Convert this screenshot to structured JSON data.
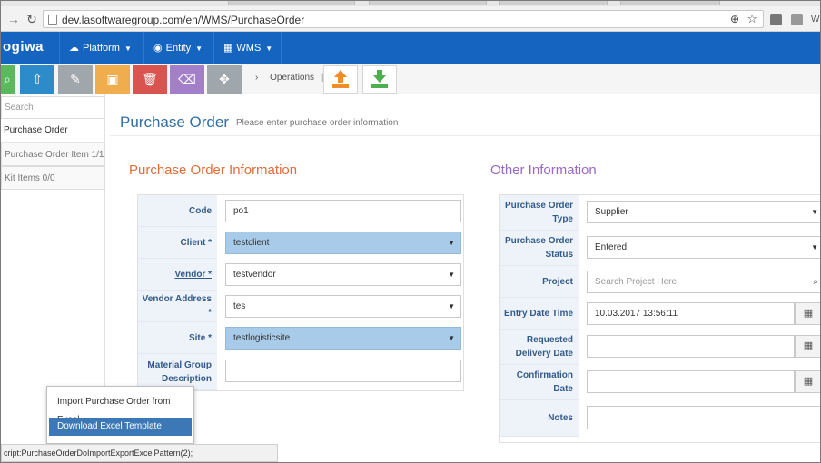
{
  "browser": {
    "url": "dev.lasoftwaregroup.com/en/WMS/PurchaseOrder",
    "right_label": "W"
  },
  "app": {
    "logo": "ogiwa",
    "nav": [
      {
        "label": "Platform",
        "icon": "cloud-icon"
      },
      {
        "label": "Entity",
        "icon": "globe-icon"
      },
      {
        "label": "WMS",
        "icon": "building-icon"
      }
    ]
  },
  "toolbar": {
    "buttons": [
      {
        "icon": "search-icon",
        "color": "#5cb85c"
      },
      {
        "icon": "upload-icon",
        "color": "#2e8bc9"
      },
      {
        "icon": "edit-icon",
        "color": "#a0a7ac"
      },
      {
        "icon": "save-icon",
        "color": "#f0ad4e"
      },
      {
        "icon": "delete-icon",
        "color": "#d9534f"
      },
      {
        "icon": "eraser-icon",
        "color": "#a47fc9"
      },
      {
        "icon": "move-icon",
        "color": "#a0a7ac"
      }
    ],
    "breadcrumb": "Operations",
    "export_icon": "export-upload-icon",
    "import_icon": "import-download-icon"
  },
  "sidebar": {
    "search_placeholder": "Search",
    "items": [
      {
        "label": "Purchase Order"
      },
      {
        "label": "Purchase Order Item 1/1"
      },
      {
        "label": "Kit Items 0/0"
      }
    ]
  },
  "page": {
    "title": "Purchase Order",
    "subtitle": "Please enter purchase order information"
  },
  "left_section": {
    "title": "Purchase Order Information",
    "fields": {
      "code": {
        "label": "Code",
        "value": "po1"
      },
      "client": {
        "label": "Client *",
        "value": "testclient"
      },
      "vendor": {
        "label": "Vendor *",
        "value": "testvendor"
      },
      "vendor_address": {
        "label": "Vendor Address *",
        "value": "tes"
      },
      "site": {
        "label": "Site *",
        "value": "testlogisticsite"
      },
      "material_group": {
        "label": "Material Group Description",
        "value": ""
      }
    }
  },
  "right_section": {
    "title": "Other Information",
    "fields": {
      "po_type": {
        "label": "Purchase Order Type",
        "value": "Supplier"
      },
      "po_status": {
        "label": "Purchase Order Status",
        "value": "Entered"
      },
      "project": {
        "label": "Project",
        "placeholder": "Search Project Here"
      },
      "entry_date": {
        "label": "Entry Date Time",
        "value": "10.03.2017 13:56:11"
      },
      "requested_delivery": {
        "label": "Requested Delivery Date",
        "value": ""
      },
      "confirmation_date": {
        "label": "Confirmation Date",
        "value": ""
      },
      "notes": {
        "label": "Notes",
        "value": ""
      }
    }
  },
  "popup_menu": {
    "items": [
      {
        "label": "Import Purchase Order from Excel"
      },
      {
        "label": "Download Excel Template"
      }
    ]
  },
  "statusbar": {
    "text": "cript:PurchaseOrderDoImportExportExcelPattern(2);"
  }
}
